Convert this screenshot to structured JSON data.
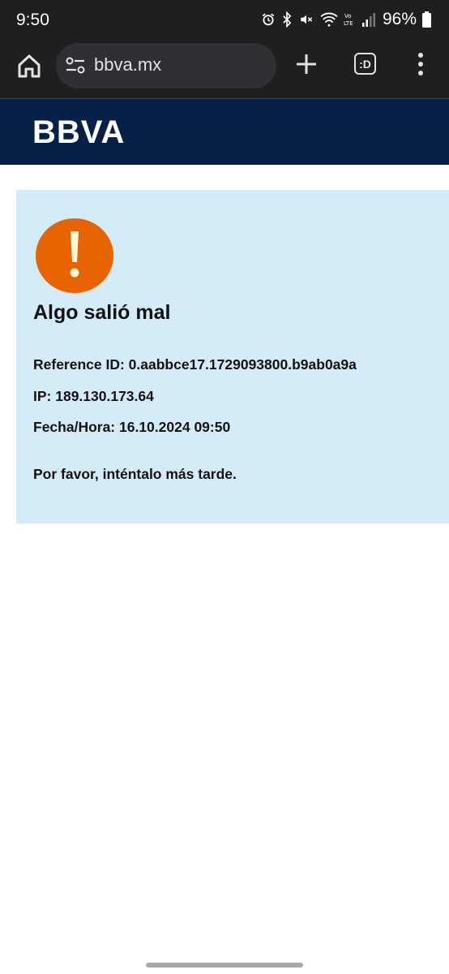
{
  "status_bar": {
    "time": "9:50",
    "battery": "96%",
    "icons": [
      "alarm-icon",
      "bluetooth-icon",
      "mute-icon",
      "wifi-calling-icon",
      "volte-icon",
      "signal-icon",
      "battery-icon"
    ]
  },
  "browser": {
    "url": "bbva.mx",
    "tab_switcher_label": ":D",
    "icons": [
      "home-icon",
      "site-settings-icon",
      "plus-icon",
      "more-vert-icon"
    ]
  },
  "header": {
    "logo_text": "BBVA",
    "background": "#072146"
  },
  "error": {
    "title": "Algo salió mal",
    "reference_id": "Reference ID: 0.aabbce17.1729093800.b9ab0a9a",
    "ip": "IP: 189.130.173.64",
    "datetime": "Fecha/Hora: 16.10.2024 09:50",
    "message": "Por favor, inténtalo más tarde.",
    "icon": "warning-icon",
    "panel_color": "#d4ebf8",
    "icon_color": "#e86400"
  }
}
